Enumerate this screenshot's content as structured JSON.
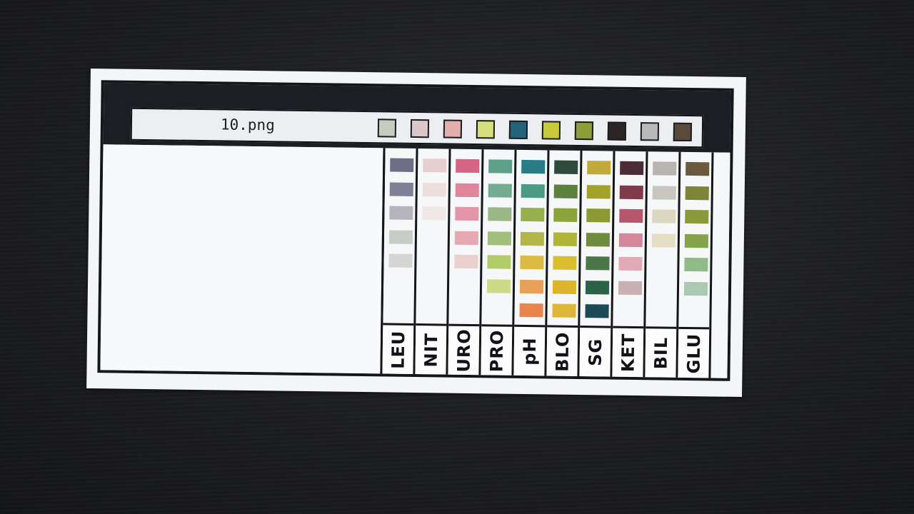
{
  "filename": "10.png",
  "sample_colors": [
    "#c8cbc0",
    "#dcc6c8",
    "#e2aeae",
    "#d6de7e",
    "#23637a",
    "#c9c93a",
    "#8d9d3a",
    "#2c2524",
    "#b9b9b9",
    "#5a4a3c"
  ],
  "columns": [
    {
      "label": "LEU",
      "swatches": [
        "#6f6e86",
        "#807f94",
        "#b5b3bb",
        "#c8cbc6",
        "#d5d6d3"
      ]
    },
    {
      "label": "NIT",
      "swatches": [
        "#e6cfd1",
        "#ecdedd",
        "#f1e7e7"
      ]
    },
    {
      "label": "URO",
      "swatches": [
        "#d66482",
        "#e0859a",
        "#e496a8",
        "#e6a9b4",
        "#ead0cc"
      ]
    },
    {
      "label": "PRO",
      "swatches": [
        "#5e9f8a",
        "#74ab91",
        "#9ab886",
        "#a1bf7a",
        "#b4cb6a",
        "#cddb88"
      ]
    },
    {
      "label": "pH",
      "swatches": [
        "#2a7d87",
        "#4d9a82",
        "#96b04d",
        "#b1b646",
        "#dcbb44",
        "#e6a057",
        "#e9844c"
      ]
    },
    {
      "label": "BLO",
      "swatches": [
        "#2d4a3a",
        "#5c803d",
        "#8ba43b",
        "#afb536",
        "#d8be2d",
        "#ddb52b",
        "#deb73a"
      ]
    },
    {
      "label": "SG",
      "swatches": [
        "#c2aa3a",
        "#a3a22b",
        "#8d9a34",
        "#6f8b3e",
        "#4c7748",
        "#2a6147",
        "#1c4b55"
      ]
    },
    {
      "label": "KET",
      "swatches": [
        "#4c2d36",
        "#7e3b4c",
        "#b8566b",
        "#d6869a",
        "#e1aab6",
        "#c9b0b3"
      ]
    },
    {
      "label": "BIL",
      "swatches": [
        "#b8b4b0",
        "#c8c6bf",
        "#ddd7c2",
        "#e6dec4"
      ]
    },
    {
      "label": "GLU",
      "swatches": [
        "#6b5a3c",
        "#7c8436",
        "#8a9a38",
        "#85a34a",
        "#8ebb86",
        "#a9c9b1"
      ]
    }
  ]
}
